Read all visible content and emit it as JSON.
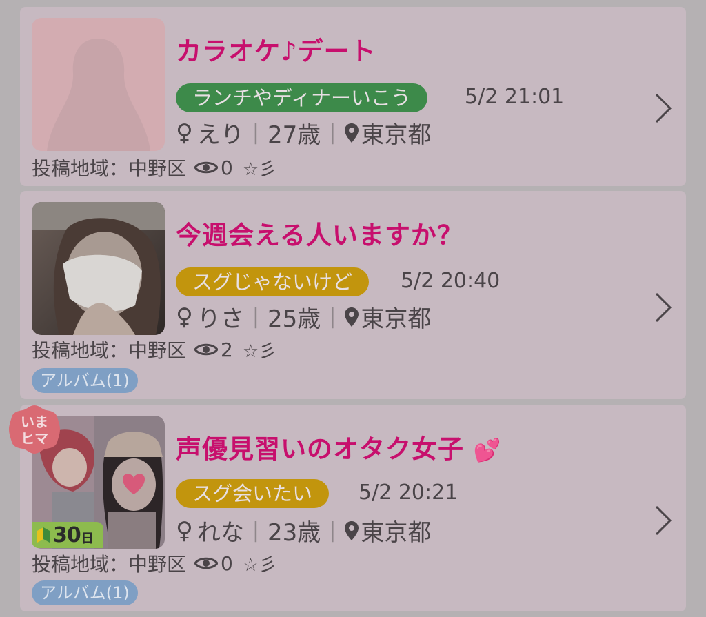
{
  "posts": [
    {
      "title": "カラオケ♪デート",
      "title_suffix": "",
      "tag": "ランチやディナーいこう",
      "tag_color": "#3d8a4a",
      "time": "5/2 21:01",
      "gender_symbol": "♀",
      "name": "えり",
      "age": "27歳",
      "location": "東京都",
      "area": "投稿地域：中野区",
      "views": "0",
      "extra": "☆彡",
      "album": ""
    },
    {
      "title": "今週会える人いますか？",
      "title_suffix": "",
      "tag": "スグじゃないけど",
      "tag_color": "#c2950d",
      "time": "5/2 20:40",
      "gender_symbol": "♀",
      "name": "りさ",
      "age": "25歳",
      "location": "東京都",
      "area": "投稿地域：中野区",
      "views": "2",
      "extra": "☆彡",
      "album": "アルバム(1)"
    },
    {
      "title": "声優見習いのオタク女子",
      "title_suffix": "💕",
      "tag": "スグ会いたい",
      "tag_color": "#c2950d",
      "time": "5/2 20:21",
      "gender_symbol": "♀",
      "name": "れな",
      "age": "23歳",
      "location": "東京都",
      "area": "投稿地域：中野区",
      "views": "0",
      "extra": "☆彡",
      "album": "アルバム(1)",
      "badge_now": [
        "いま",
        "ヒマ"
      ],
      "badge_days": {
        "num": "30",
        "unit": "日"
      }
    }
  ],
  "icons": {
    "pin": "map-pin-icon",
    "eye": "eye-icon",
    "chevron": "chevron-right-icon",
    "beginner": "beginner-leaf-icon"
  },
  "colors": {
    "title": "#c70f6d",
    "card_bg": "#c7b9c1",
    "page_bg": "#b5b1b3",
    "album": "#7f9fc4"
  }
}
